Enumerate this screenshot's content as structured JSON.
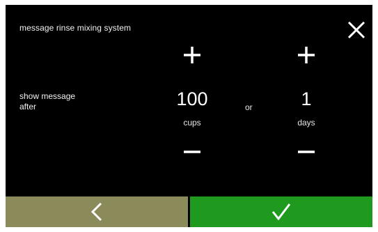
{
  "screen": {
    "title": "message rinse mixing system",
    "label": "show message\nafter",
    "or_text": "or"
  },
  "cups": {
    "value": "100",
    "unit": "cups"
  },
  "days": {
    "value": "1",
    "unit": "days"
  },
  "icons": {
    "close": "close-icon",
    "plus": "plus-icon",
    "minus": "minus-icon",
    "back": "chevron-left-icon",
    "confirm": "checkmark-icon"
  },
  "colors": {
    "background": "#000000",
    "text": "#ffffff",
    "back_button": "#8a8a5a",
    "confirm_button": "#1f9a1f"
  }
}
